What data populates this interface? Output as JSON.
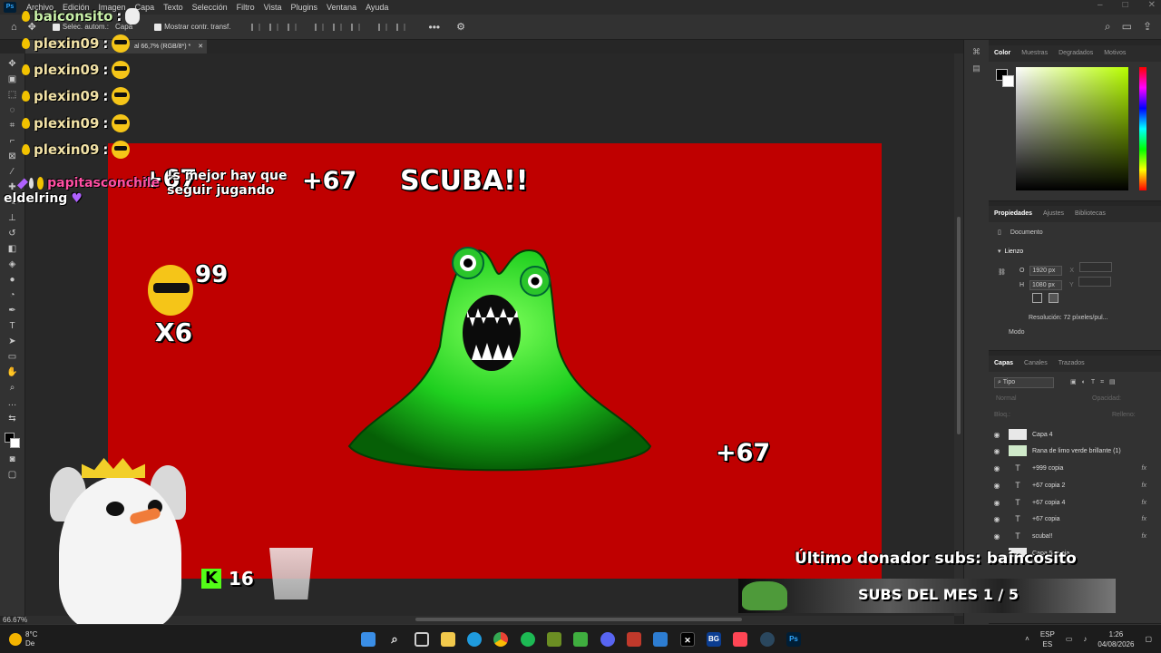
{
  "menu": {
    "items": [
      "Archivo",
      "Edición",
      "Imagen",
      "Capa",
      "Texto",
      "Selección",
      "Filtro",
      "Vista",
      "Plugins",
      "Ventana",
      "Ayuda"
    ]
  },
  "options": {
    "auto_select": "Selec. autom.:",
    "auto_select_target": "Capa",
    "show_transform": "Mostrar contr. transf."
  },
  "doc_tab": {
    "title": "al 66,7% (RGB/8*) *"
  },
  "status": {
    "zoom": "66.67%"
  },
  "canvas": {
    "texts": [
      "+67",
      "+67",
      "SCUBA!!",
      "99",
      "X6",
      "+67"
    ],
    "background": "#bf0000"
  },
  "panels": {
    "color_tabs": [
      "Color",
      "Muestras",
      "Degradados",
      "Motivos"
    ],
    "props_tabs": [
      "Propiedades",
      "Ajustes",
      "Bibliotecas"
    ],
    "document_label": "Documento",
    "canvas_label": "Lienzo",
    "width_label": "O",
    "width_value": "1920 px",
    "height_label": "H",
    "height_value": "1080 px",
    "x_label": "X",
    "y_label": "Y",
    "resolution": "Resolución: 72 píxeles/pul...",
    "mode_label": "Modo",
    "layers_tabs": [
      "Capas",
      "Canales",
      "Trazados"
    ],
    "filter_label": "Tipo",
    "blend_mode": "Normal",
    "opacity_label": "Opacidad:",
    "fill_label": "Relleno:",
    "lock_label": "Bloq.:",
    "layers": [
      {
        "name": "Capa 4",
        "kind": "image",
        "fx": ""
      },
      {
        "name": "Rana de limo verde brillante (1)",
        "kind": "image",
        "fx": ""
      },
      {
        "name": "+999 copia",
        "kind": "text",
        "fx": "fx"
      },
      {
        "name": "+67 copia 2",
        "kind": "text",
        "fx": "fx"
      },
      {
        "name": "+67 copia 4",
        "kind": "text",
        "fx": "fx"
      },
      {
        "name": "+67 copia",
        "kind": "text",
        "fx": "fx"
      },
      {
        "name": "scuba!!",
        "kind": "text",
        "fx": "fx"
      },
      {
        "name": "Capa 5 copia",
        "kind": "image",
        "fx": ""
      }
    ]
  },
  "overlay": {
    "chat": [
      {
        "user": "baiconsito",
        "sep": ":"
      },
      {
        "user": "plexin09",
        "sep": ":"
      },
      {
        "user": "plexin09",
        "sep": ":"
      },
      {
        "user": "plexin09",
        "sep": ":"
      },
      {
        "user": "plexin09",
        "sep": ":"
      },
      {
        "user": "plexin09",
        "sep": ":"
      },
      {
        "user": "papitasconchile",
        "sep": ":",
        "msg": "!s mejor hay que seguir jugando"
      },
      {
        "user": "eldelring",
        "sep": ""
      }
    ],
    "kick_count": "16",
    "donor_text": "Último donador subs: baincosito",
    "subs_text": "SUBS DEL MES 1 / 5"
  },
  "taskbar": {
    "weather_temp": "8°C",
    "weather_sub": "De",
    "lang_top": "ESP",
    "lang_bottom": "ES",
    "time": "1:26",
    "date": "04/08/2026"
  }
}
